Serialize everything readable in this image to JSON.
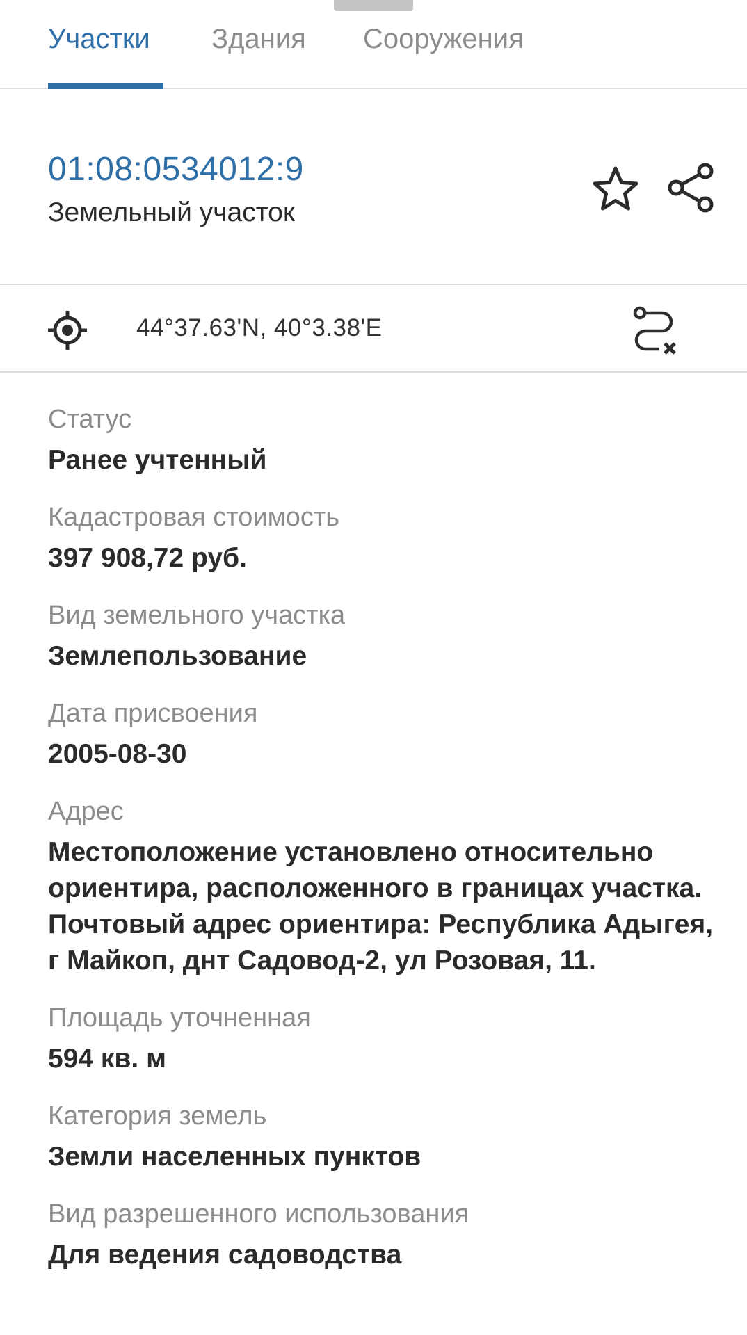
{
  "tabs": [
    {
      "label": "Участки",
      "active": true
    },
    {
      "label": "Здания",
      "active": false
    },
    {
      "label": "Сооружения",
      "active": false
    }
  ],
  "header": {
    "cadastral_number": "01:08:0534012:9",
    "object_type": "Земельный участок",
    "favorite_icon": "star-icon",
    "share_icon": "share-icon"
  },
  "location": {
    "coordinates": "44°37.63'N, 40°3.38'E",
    "locate_icon": "crosshair-icon",
    "route_clear_icon": "route-clear-icon"
  },
  "properties": [
    {
      "label": "Статус",
      "value": "Ранее учтенный"
    },
    {
      "label": "Кадастровая стоимость",
      "value": "397 908,72 руб."
    },
    {
      "label": "Вид земельного участка",
      "value": "Землепользование"
    },
    {
      "label": "Дата присвоения",
      "value": "2005-08-30"
    },
    {
      "label": "Адрес",
      "value": "Местоположение установлено относительно ориентира, расположенного в границах участка. Почтовый адрес ориентира: Республика Адыгея, г Майкоп, днт Садовод-2, ул Розовая, 11."
    },
    {
      "label": "Площадь уточненная",
      "value": "594 кв. м"
    },
    {
      "label": "Категория земель",
      "value": "Земли населенных пунктов"
    },
    {
      "label": "Вид разрешенного использования",
      "value": "Для ведения садоводства"
    }
  ],
  "colors": {
    "accent": "#2f6fa8",
    "label_gray": "#8c8c8c",
    "text": "#2b2b2b",
    "divider": "#dcdcdc"
  }
}
